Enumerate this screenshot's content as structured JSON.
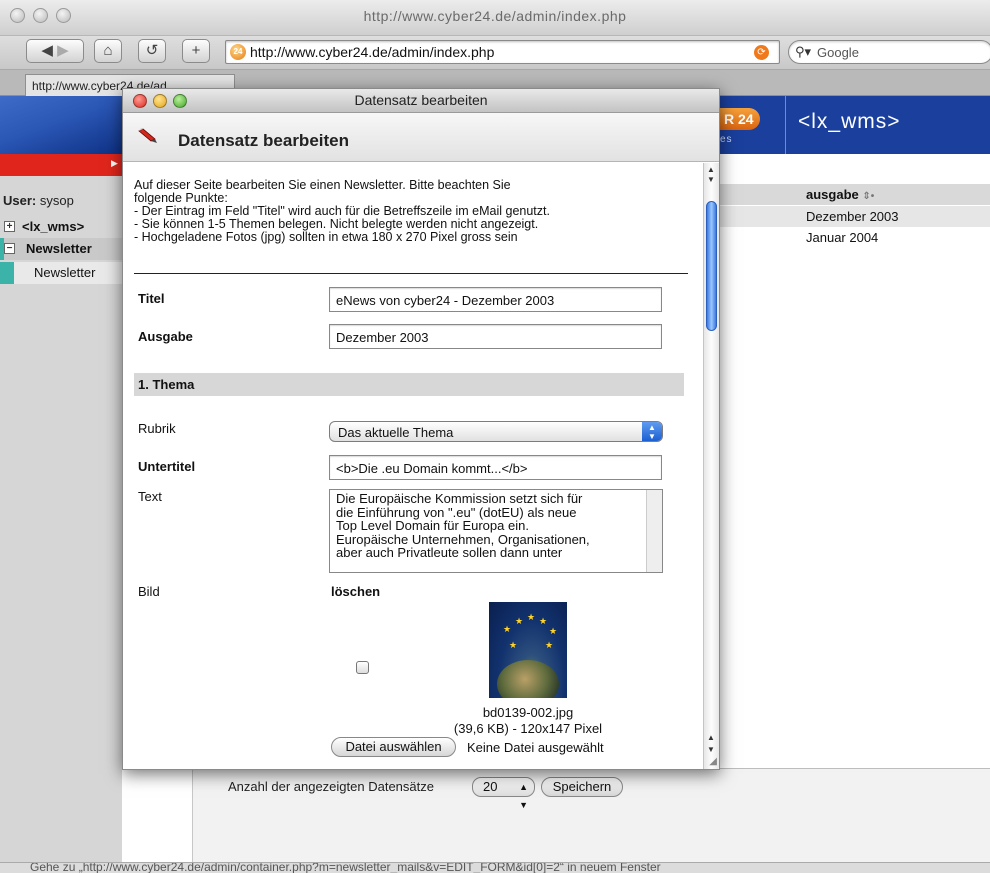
{
  "browser": {
    "window_title": "http://www.cyber24.de/admin/index.php",
    "url": "http://www.cyber24.de/admin/index.php",
    "search_placeholder": "Google",
    "tab_label": "http://www.cyber24.de/ad",
    "status_text": "Gehe zu „http://www.cyber24.de/admin/container.php?m=newsletter_mails&v=EDIT_FORM&id[0]=2“ in neuem Fenster"
  },
  "site": {
    "brand_badge": "R 24",
    "brand_small": "es",
    "brand_title": "<lx_wms>",
    "user_label": "User:",
    "user_name": "sysop",
    "tree": [
      "<lx_wms>",
      "Newsletter",
      "Newsletter"
    ],
    "list_header": "ausgabe",
    "list_rows": [
      "Dezember 2003",
      "Januar 2004"
    ],
    "count_label": "Anzahl der angezeigten Datensätze",
    "count_value": "20",
    "save_label": "Speichern"
  },
  "dialog": {
    "window_title": "Datensatz bearbeiten",
    "heading": "Datensatz bearbeiten",
    "intro_lines": [
      "Auf dieser Seite bearbeiten Sie einen Newsletter. Bitte beachten Sie",
      "folgende Punkte:",
      "- Der Eintrag im Feld \"Titel\" wird auch für die Betreffszeile im eMail genutzt.",
      "- Sie können 1-5 Themen belegen. Nicht belegte werden nicht angezeigt.",
      "- Hochgeladene Fotos (jpg) sollten in etwa 180 x 270 Pixel gross sein"
    ],
    "fields": {
      "titel_label": "Titel",
      "titel_value": "eNews von cyber24 - Dezember 2003",
      "ausgabe_label": "Ausgabe",
      "ausgabe_value": "Dezember 2003",
      "section_label": "1. Thema",
      "rubrik_label": "Rubrik",
      "rubrik_value": "Das aktuelle Thema",
      "untertitel_label": "Untertitel",
      "untertitel_value": "<b>Die .eu Domain kommt...</b>",
      "text_label": "Text",
      "text_lines": [
        "Die Europäische Kommission setzt sich für",
        "die Einführung von \".eu\" (dotEU) als neue",
        "Top Level Domain für Europa ein.",
        "Europäische Unternehmen, Organisationen,",
        "aber auch Privatleute sollen dann unter"
      ],
      "bild_label": "Bild",
      "delete_label": "löschen",
      "file_name": "bd0139-002.jpg",
      "file_meta": "(39,6 KB) - 120x147 Pixel",
      "choose_label": "Datei auswählen",
      "no_file_label": "Keine Datei ausgewählt"
    }
  }
}
